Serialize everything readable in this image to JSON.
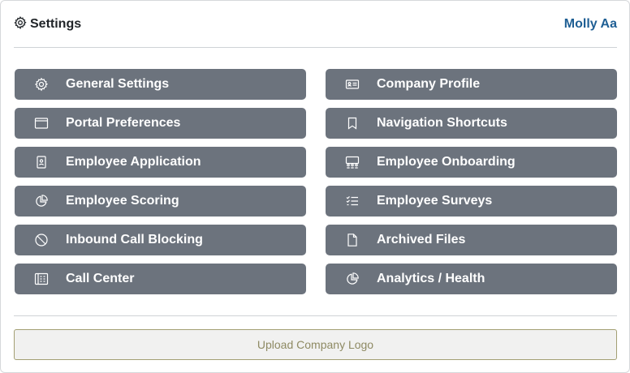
{
  "header": {
    "title": "Settings",
    "title_icon": "gear-icon",
    "user_name": "Molly Aa",
    "user_color": "#1f5f94"
  },
  "tiles": [
    {
      "label": "General Settings",
      "icon": "gear-icon"
    },
    {
      "label": "Company Profile",
      "icon": "id-card-icon"
    },
    {
      "label": "Portal Preferences",
      "icon": "window-icon"
    },
    {
      "label": "Navigation Shortcuts",
      "icon": "bookmark-icon"
    },
    {
      "label": "Employee Application",
      "icon": "badge-icon"
    },
    {
      "label": "Employee Onboarding",
      "icon": "people-board-icon"
    },
    {
      "label": "Employee Scoring",
      "icon": "pie-chart-icon"
    },
    {
      "label": "Employee Surveys",
      "icon": "checklist-icon"
    },
    {
      "label": "Inbound Call Blocking",
      "icon": "block-icon"
    },
    {
      "label": "Archived Files",
      "icon": "file-icon"
    },
    {
      "label": "Call Center",
      "icon": "building-icon"
    },
    {
      "label": "Analytics / Health",
      "icon": "pie-chart-icon"
    }
  ],
  "upload": {
    "label": "Upload Company Logo"
  },
  "colors": {
    "tile_bg": "#6c737d",
    "upload_border": "#a39f73",
    "upload_text": "#8e8a63"
  }
}
